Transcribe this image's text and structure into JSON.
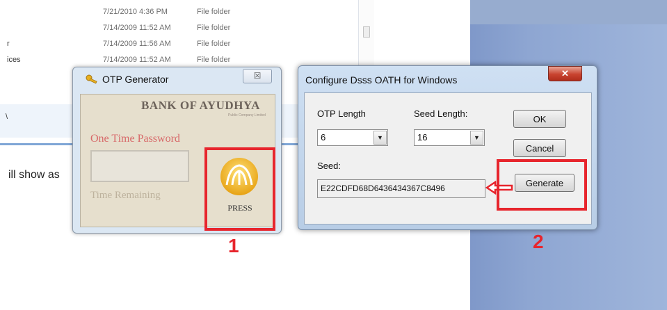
{
  "explorer": {
    "rows": [
      {
        "left": "",
        "date": "7/21/2010 4:36 PM",
        "type": "File folder"
      },
      {
        "left": "",
        "date": "7/14/2009 11:52 AM",
        "type": "File folder"
      },
      {
        "left": "r",
        "date": "7/14/2009 11:56 AM",
        "type": "File folder"
      },
      {
        "left": "ices",
        "date": "7/14/2009 11:52 AM",
        "type": "File folder"
      }
    ],
    "selected_row_text": "\\",
    "partial_text": "ill show as"
  },
  "otp_window": {
    "title": "OTP Generator",
    "close_glyph": "☒",
    "bank_name": "BANK OF AYUDHYA",
    "bank_subtitle": "Public Company Limited",
    "heading": "One Time Password",
    "otp_value": "",
    "time_remaining_label": "Time Remaining",
    "press_label": "PRESS"
  },
  "config_dialog": {
    "title": "Configure Dsss OATH for Windows",
    "close_glyph": "✕",
    "otp_length_label": "OTP Length",
    "otp_length_value": "6",
    "seed_length_label": "Seed Length:",
    "seed_length_value": "16",
    "seed_label": "Seed:",
    "seed_value": "E22CDFD68D6436434367C8496",
    "ok_label": "OK",
    "cancel_label": "Cancel",
    "generate_label": "Generate"
  },
  "annotations": {
    "step1": "1",
    "step2": "2",
    "highlight_color": "#e7252d"
  }
}
